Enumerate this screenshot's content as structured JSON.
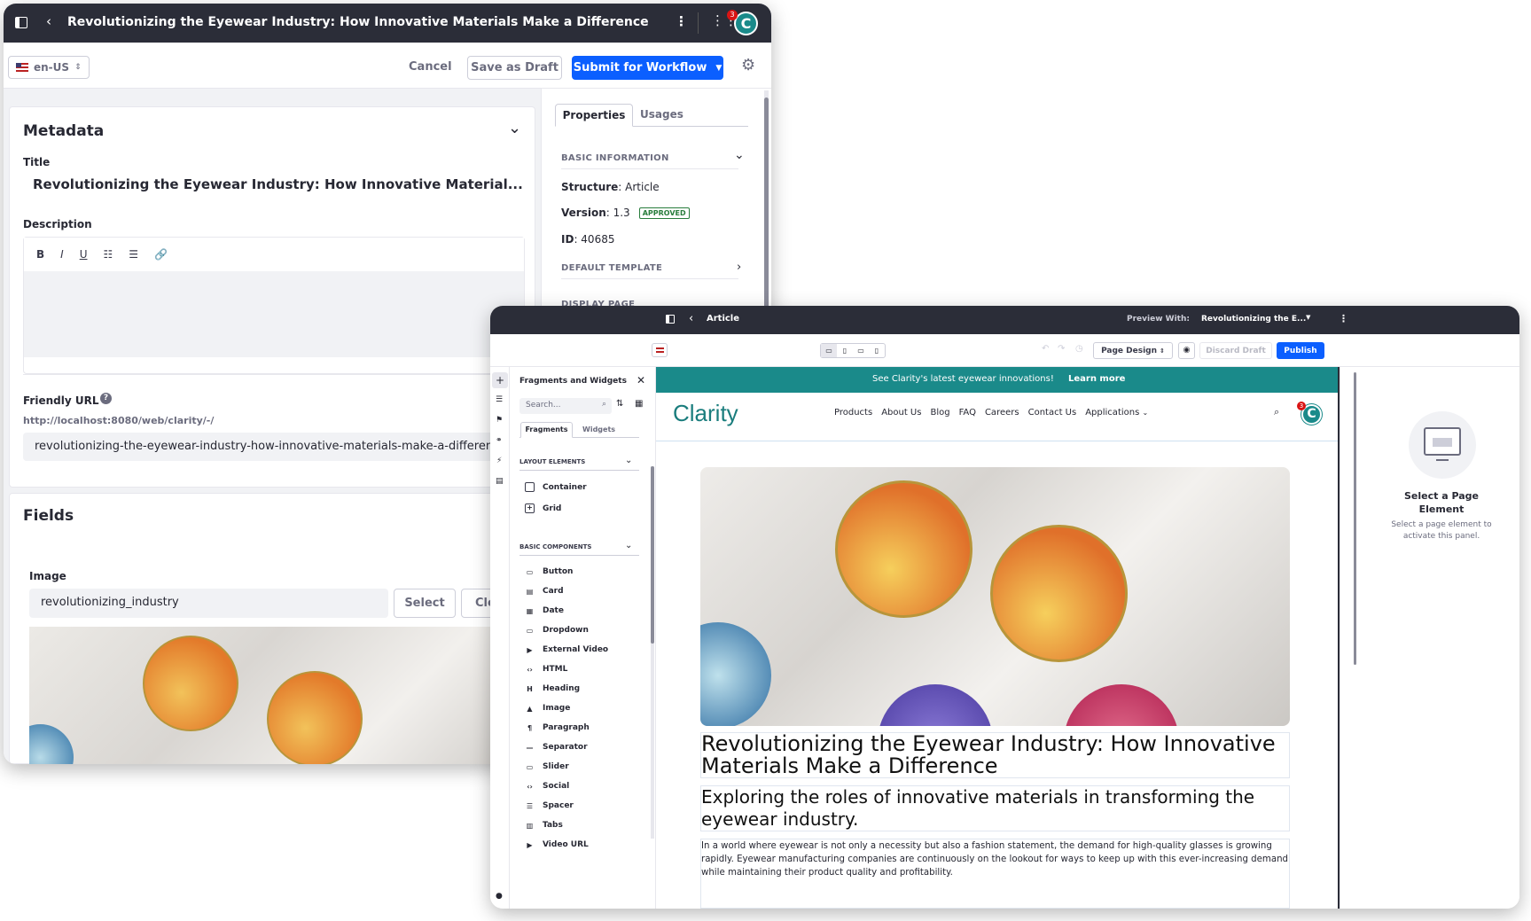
{
  "editor": {
    "title": "Revolutionizing the Eyewear Industry: How Innovative Materials Make a Difference",
    "notification_count": "3",
    "avatar_letter": "C",
    "locale": "en-US",
    "cancel_label": "Cancel",
    "save_draft_label": "Save as Draft",
    "submit_label": "Submit for Workflow",
    "metadata": {
      "heading": "Metadata",
      "title_label": "Title",
      "title_value": "Revolutionizing the Eyewear Industry: How Innovative Material...",
      "description_label": "Description",
      "friendly_url_label": "Friendly URL",
      "friendly_url_base": "http://localhost:8080/web/clarity/-/",
      "friendly_url_value": "revolutionizing-the-eyewear-industry-how-innovative-materials-make-a-difference"
    },
    "fields": {
      "heading": "Fields",
      "image_label": "Image",
      "image_value": "revolutionizing_industry",
      "select_label": "Select",
      "clear_label": "Clear"
    },
    "properties": {
      "tabs": [
        "Properties",
        "Usages"
      ],
      "basic_information": "BASIC INFORMATION",
      "structure_label": "Structure",
      "structure_value": "Article",
      "version_label": "Version",
      "version_value": "1.3",
      "status": "APPROVED",
      "id_label": "ID",
      "id_value": "40685",
      "default_template": "DEFAULT TEMPLATE",
      "display_page": "DISPLAY PAGE"
    }
  },
  "page_editor": {
    "title": "Article",
    "preview_with_label": "Preview With:",
    "preview_with_value": "Revolutionizing the E...",
    "page_design_label": "Page Design",
    "discard_draft_label": "Discard Draft",
    "publish_label": "Publish",
    "fragments_panel": {
      "title": "Fragments and Widgets",
      "search_placeholder": "Search...",
      "tabs": [
        "Fragments",
        "Widgets"
      ],
      "layout_elements": {
        "title": "LAYOUT ELEMENTS",
        "items": [
          "Container",
          "Grid"
        ]
      },
      "basic_components": {
        "title": "BASIC COMPONENTS",
        "items": [
          "Button",
          "Card",
          "Date",
          "Dropdown",
          "External Video",
          "HTML",
          "Heading",
          "Image",
          "Paragraph",
          "Separator",
          "Slider",
          "Social",
          "Spacer",
          "Tabs",
          "Video URL"
        ]
      }
    },
    "site": {
      "banner_text": "See Clarity's latest eyewear innovations!",
      "banner_link": "Learn more",
      "logo": "Clarity",
      "nav": [
        "Products",
        "About Us",
        "Blog",
        "FAQ",
        "Careers",
        "Contact Us",
        "Applications"
      ],
      "notification_count": "3",
      "avatar_letter": "C",
      "article_heading": "Revolutionizing the Eyewear Industry: How Innovative Materials Make a Difference",
      "article_subheading": "Exploring the roles of innovative materials in transforming the eyewear industry.",
      "article_paragraph": "In a world where eyewear is not only a necessity but also a fashion statement, the demand for high-quality glasses is growing rapidly. Eyewear manufacturing companies are continuously on the lookout for ways to keep up with this ever-increasing demand while maintaining their product quality and profitability."
    },
    "right_panel": {
      "title": "Select a Page Element",
      "hint": "Select a page element to activate this panel."
    }
  },
  "colors": {
    "primary": "#0b5fff",
    "topbar": "#2b2d38",
    "banner": "#1a8a8a",
    "approved": "#287d3c",
    "avatar": "#1a8a8a"
  }
}
